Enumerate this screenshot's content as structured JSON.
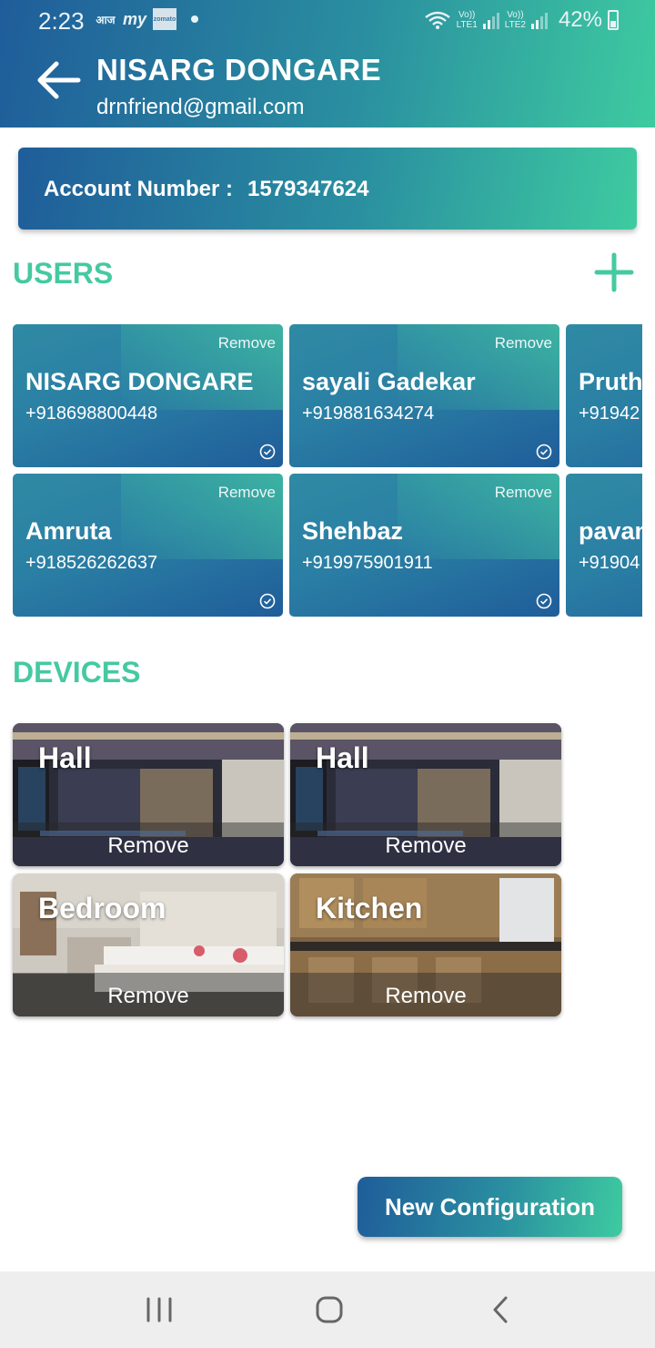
{
  "status_bar": {
    "time": "2:23",
    "left_icons": [
      "aajtak-icon",
      "myntra-icon",
      "zomato-icon"
    ],
    "sim1": "Vo))\nLTE1",
    "sim2": "Vo))\nLTE2",
    "battery": "42%"
  },
  "header": {
    "title": "NISARG DONGARE",
    "subtitle": "drnfriend@gmail.com"
  },
  "account": {
    "label": "Account Number :",
    "number": "1579347624"
  },
  "users": {
    "title": "USERS",
    "remove_label": "Remove",
    "items": [
      {
        "name": "NISARG DONGARE",
        "phone": "+918698800448"
      },
      {
        "name": "sayali Gadekar",
        "phone": "+919881634274"
      },
      {
        "name": "Pruthv",
        "phone": "+91942"
      },
      {
        "name": "Amruta",
        "phone": "+918526262637"
      },
      {
        "name": "Shehbaz",
        "phone": "+919975901911"
      },
      {
        "name": "pavan",
        "phone": "+91904"
      }
    ]
  },
  "devices": {
    "title": "DEVICES",
    "remove_label": "Remove",
    "items": [
      {
        "name": "Hall"
      },
      {
        "name": "Hall"
      },
      {
        "name": "Bedroom"
      },
      {
        "name": "Kitchen"
      }
    ]
  },
  "new_config_label": "New Configuration",
  "colors": {
    "accent": "#45c9a1",
    "gradient_start": "#1f5d9a",
    "gradient_end": "#3ecba0"
  }
}
